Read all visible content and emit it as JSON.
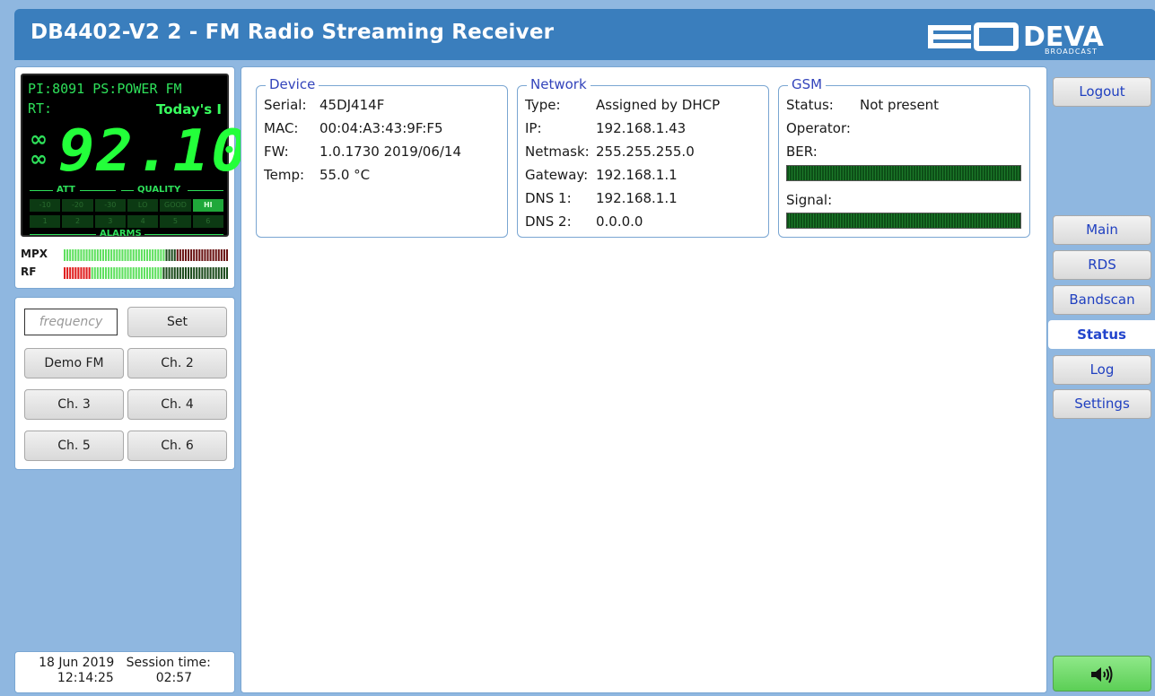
{
  "header": {
    "title": "DB4402-V2 2 - FM Radio Streaming Receiver",
    "logo_text": "DEVA",
    "logo_sub": "BROADCAST"
  },
  "lcd": {
    "pi_label": "PI:",
    "pi": "8091",
    "ps_label": "PS:",
    "ps": "POWER FM",
    "rt_label": "RT:",
    "rt": "Today's I",
    "frequency": "92.10",
    "att_label": "ATT",
    "quality_label": "QUALITY",
    "alarms_label": "ALARMS",
    "att_cells": [
      "-10",
      "-20",
      "-30"
    ],
    "quality_cells": [
      "LO",
      "GOOD",
      "HI"
    ],
    "quality_active": "HI",
    "alarm_cells": [
      "1",
      "2",
      "3",
      "4",
      "5",
      "6"
    ]
  },
  "meters": {
    "mpx_label": "MPX",
    "rf_label": "RF",
    "mpx_level": 0.62,
    "rf_level": 0.6
  },
  "tune": {
    "frequency_placeholder": "frequency",
    "set_label": "Set",
    "channels": [
      "Demo FM",
      "Ch. 2",
      "Ch. 3",
      "Ch. 4",
      "Ch. 5",
      "Ch. 6"
    ]
  },
  "clock": {
    "date": "18 Jun 2019",
    "time": "12:14:25",
    "session_label": "Session time:",
    "session": "02:57"
  },
  "device": {
    "legend": "Device",
    "serial_label": "Serial:",
    "serial": "45DJ414F",
    "mac_label": "MAC:",
    "mac": "00:04:A3:43:9F:F5",
    "fw_label": "FW:",
    "fw": "1.0.1730 2019/06/14",
    "temp_label": "Temp:",
    "temp": "55.0 °C"
  },
  "network": {
    "legend": "Network",
    "type_label": "Type:",
    "type": "Assigned by DHCP",
    "ip_label": "IP:",
    "ip": "192.168.1.43",
    "netmask_label": "Netmask:",
    "netmask": "255.255.255.0",
    "gateway_label": "Gateway:",
    "gateway": "192.168.1.1",
    "dns1_label": "DNS 1:",
    "dns1": "192.168.1.1",
    "dns2_label": "DNS 2:",
    "dns2": "0.0.0.0"
  },
  "gsm": {
    "legend": "GSM",
    "status_label": "Status:",
    "status": "Not present",
    "operator_label": "Operator:",
    "operator": "",
    "ber_label": "BER:",
    "signal_label": "Signal:"
  },
  "nav": {
    "logout": "Logout",
    "items": [
      "Main",
      "RDS",
      "Bandscan",
      "Status",
      "Log",
      "Settings"
    ],
    "active": "Status"
  },
  "colors": {
    "header": "#3a7ebd",
    "background": "#8fb7e0",
    "lcd_green": "#23ff3a",
    "sound_button": "#5ccf56"
  }
}
